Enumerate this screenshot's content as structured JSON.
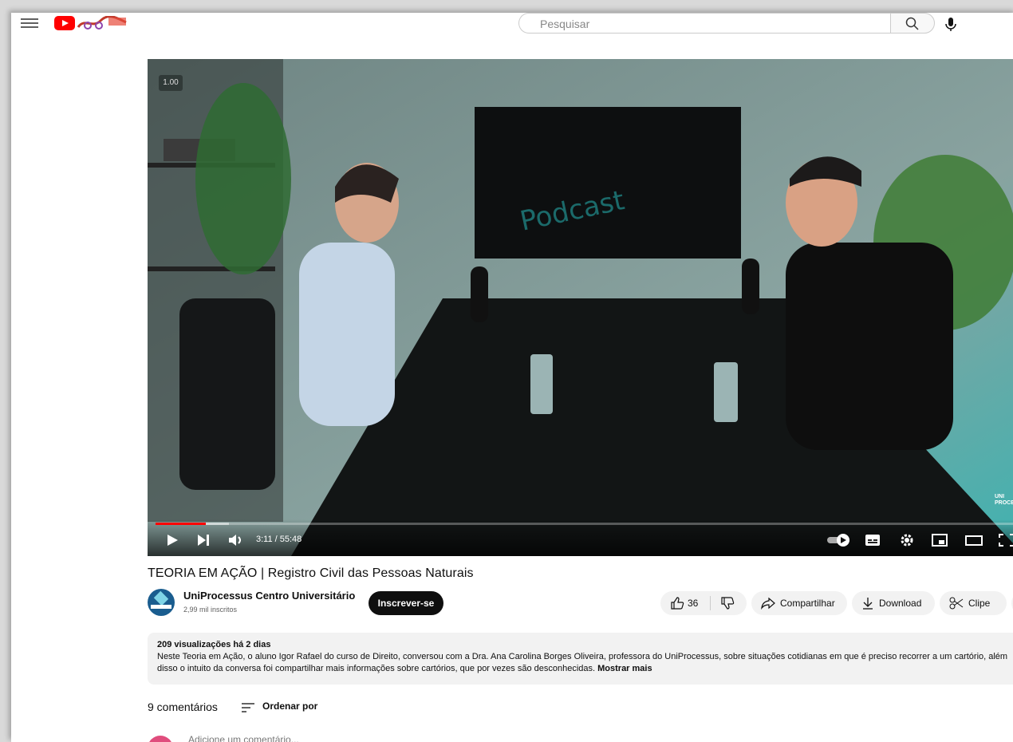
{
  "search": {
    "placeholder": "Pesquisar"
  },
  "player": {
    "speed_overlay": "1.00",
    "time": "3:11 / 55:48",
    "progress_played": 0.058,
    "progress_buffered": 0.085,
    "watermark": "UNI PROCESSUS"
  },
  "video": {
    "title": "TEORIA EM AÇÃO | Registro Civil das Pessoas Naturais",
    "channel": "UniProcessus Centro Universitário",
    "subscribers": "2,99 mil inscritos",
    "subscribe_label": "Inscrever-se",
    "likes": "36",
    "share_label": "Compartilhar",
    "download_label": "Download",
    "clip_label": "Clipe"
  },
  "description": {
    "stats": "209 visualizações  há 2 dias",
    "text": "Neste Teoria em Ação, o aluno Igor Rafael do curso de Direito, conversou com a Dra. Ana Carolina Borges Oliveira, professora do UniProcessus, sobre situações cotidianas em que é preciso recorrer a um cartório, além disso o intuito da conversa foi compartilhar mais informações sobre cartórios, que por vezes são desconhecidas.",
    "more_label": "Mostrar mais"
  },
  "comments": {
    "count": "9 comentários",
    "sort_label": "Ordenar por",
    "add_placeholder": "Adicione um comentário..."
  },
  "colors": {
    "accent_red": "#ff0000",
    "scene_teal": "#2fb5b5"
  }
}
